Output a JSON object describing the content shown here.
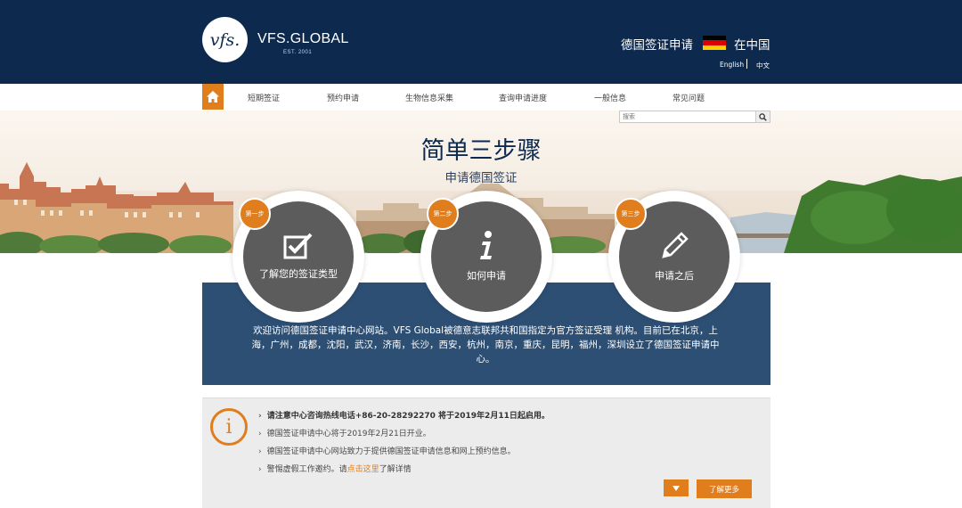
{
  "header": {
    "logo_mark": "vfs.",
    "logo_text": "VFS.GLOBAL",
    "logo_est": "EST. 2001",
    "title": "德国签证申请",
    "country": "在中国",
    "lang_en": "English",
    "lang_zh": "中文",
    "flag_colors": [
      "#000000",
      "#dd0000",
      "#ffce00"
    ]
  },
  "nav": {
    "home_icon": "home-icon",
    "items": [
      "短期签证",
      "预约申请",
      "生物信息采集",
      "查询申请进度",
      "一般信息",
      "常见问题"
    ]
  },
  "search": {
    "placeholder": "搜索"
  },
  "banner": {
    "title": "简单三步骤",
    "subtitle": "申请德国签证"
  },
  "steps": [
    {
      "badge": "第一步",
      "label": "了解您的签证类型",
      "icon": "checkbox-icon"
    },
    {
      "badge": "第二步",
      "label": "如何申请",
      "icon": "info-icon"
    },
    {
      "badge": "第三步",
      "label": "申请之后",
      "icon": "pencil-icon"
    }
  ],
  "info": {
    "text": "欢迎访问德国签证申请中心网站。VFS Global被德意志联邦共和国指定为官方签证受理 机构。目前已在北京，上海，广州，成都，沈阳，武汉，济南，长沙，西安，杭州，南京，重庆，昆明，福州，深圳设立了德国签证申请中心。"
  },
  "notice": {
    "lines": [
      "请注意中心咨询热线电话+86-20-28292270 将于2019年2月11日起启用。",
      "德国签证申请中心将于2019年2月21日开业。",
      "德国签证申请中心网站致力于提供德国签证申请信息和网上预约信息。"
    ],
    "last_prefix": "警惕虚假工作邀约。请",
    "last_link": "点击这里",
    "last_suffix": "了解详情",
    "more_label": "了解更多"
  },
  "colors": {
    "navy": "#0d2a4e",
    "orange": "#e07e1d",
    "info_blue": "#2d4f74",
    "step_grey": "#5c5c5c"
  }
}
